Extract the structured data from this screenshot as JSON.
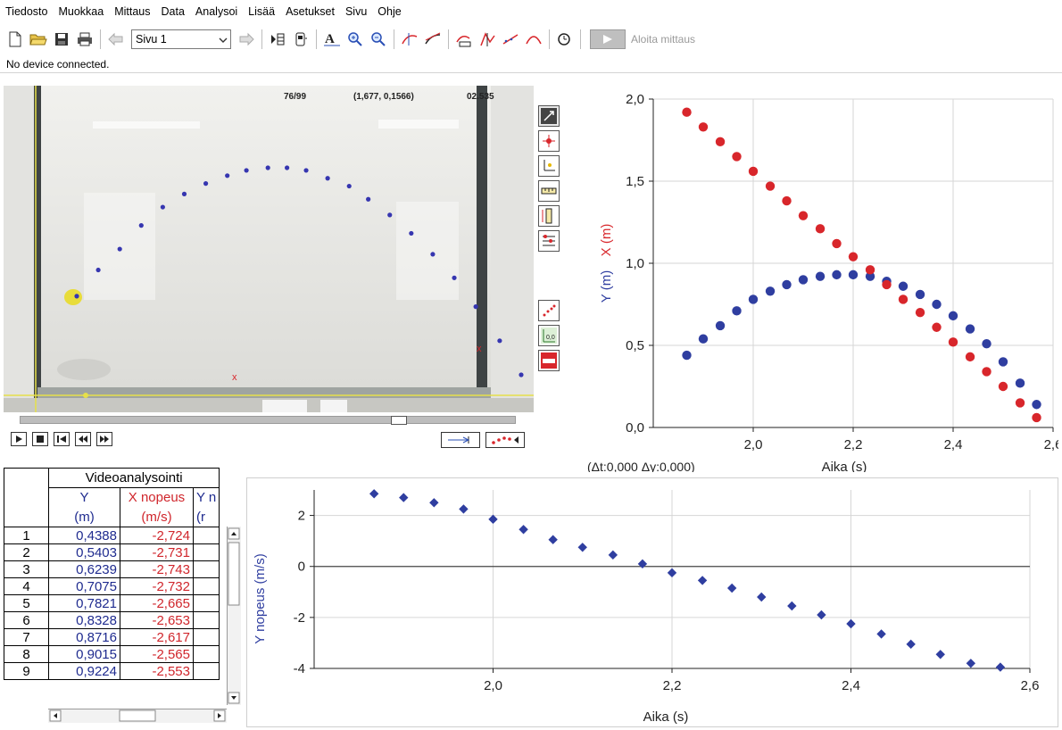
{
  "menu": [
    "Tiedosto",
    "Muokkaa",
    "Mittaus",
    "Data",
    "Analysoi",
    "Lisää",
    "Asetukset",
    "Sivu",
    "Ohje"
  ],
  "toolbar": {
    "page_select_value": "Sivu 1",
    "start_measurement_label": "Aloita mittaus",
    "icons": [
      "new-file-icon",
      "open-folder-icon",
      "save-icon",
      "print-icon",
      "prev-page-icon",
      "next-page-icon",
      "data-browser-icon",
      "sensor-icon",
      "autoscale-icon",
      "zoom-in-icon",
      "zoom-out-icon",
      "examine-icon",
      "tangent-icon",
      "statistics-icon",
      "integral-icon",
      "linear-fit-icon",
      "curve-fit-icon",
      "replay-icon"
    ]
  },
  "status": {
    "text": "No device connected."
  },
  "video": {
    "frame_counter": "76/99",
    "coordinate_readout": "(1,677, 0,1566)",
    "time_readout": "02.535",
    "marker_label": "x",
    "colors": {
      "track": "#3636b0",
      "ball": "#e8dc3a",
      "axis": "#e6e04a"
    }
  },
  "graph_top": {
    "x_label": "Aika (s)",
    "y_label_y": "Y (m)",
    "y_label_x": "X (m)",
    "delta_readout": "(Δt:0,000  Δy:0,000)",
    "x_ticks": [
      "2,0",
      "2,2",
      "2,4",
      "2,6"
    ],
    "y_ticks": [
      "0,0",
      "0,5",
      "1,0",
      "1,5",
      "2,0"
    ],
    "colors": {
      "y_series": "#2f3ea0",
      "x_series": "#d8262b"
    }
  },
  "graph_bottom": {
    "x_label": "Aika (s)",
    "y_label": "Y nopeus (m/s)",
    "x_ticks": [
      "2,0",
      "2,2",
      "2,4",
      "2,6"
    ],
    "y_ticks": [
      "2",
      "0",
      "-2",
      "-4"
    ],
    "color": "#2f3ea0"
  },
  "table": {
    "title": "Videoanalysointi",
    "headers": [
      {
        "name": "Y",
        "unit": "(m)"
      },
      {
        "name": "X nopeus",
        "unit": "(m/s)"
      },
      {
        "name": "Y n",
        "unit": "(r"
      }
    ],
    "rows": [
      {
        "n": "1",
        "y": "0,4388",
        "vx": "-2,724"
      },
      {
        "n": "2",
        "y": "0,5403",
        "vx": "-2,731"
      },
      {
        "n": "3",
        "y": "0,6239",
        "vx": "-2,743"
      },
      {
        "n": "4",
        "y": "0,7075",
        "vx": "-2,732"
      },
      {
        "n": "5",
        "y": "0,7821",
        "vx": "-2,665"
      },
      {
        "n": "6",
        "y": "0,8328",
        "vx": "-2,653"
      },
      {
        "n": "7",
        "y": "0,8716",
        "vx": "-2,617"
      },
      {
        "n": "8",
        "y": "0,9015",
        "vx": "-2,565"
      },
      {
        "n": "9",
        "y": "0,9224",
        "vx": "-2,553"
      }
    ]
  },
  "chart_data": [
    {
      "type": "scatter",
      "title": "",
      "xlabel": "Aika (s)",
      "ylabel": "Y (m), X (m)",
      "xlim": [
        1.8,
        2.6
      ],
      "ylim": [
        0.0,
        2.0
      ],
      "grid": true,
      "x": [
        1.867,
        1.9,
        1.934,
        1.967,
        2.0,
        2.034,
        2.067,
        2.1,
        2.134,
        2.167,
        2.2,
        2.234,
        2.267,
        2.3,
        2.334,
        2.367,
        2.4,
        2.434,
        2.467,
        2.5,
        2.534,
        2.567
      ],
      "series": [
        {
          "name": "Y",
          "values": [
            0.44,
            0.54,
            0.62,
            0.71,
            0.78,
            0.83,
            0.87,
            0.9,
            0.92,
            0.93,
            0.93,
            0.92,
            0.89,
            0.86,
            0.81,
            0.75,
            0.68,
            0.6,
            0.51,
            0.4,
            0.27,
            0.14
          ]
        },
        {
          "name": "X",
          "values": [
            1.92,
            1.83,
            1.74,
            1.65,
            1.56,
            1.47,
            1.38,
            1.29,
            1.21,
            1.12,
            1.04,
            0.96,
            0.87,
            0.78,
            0.7,
            0.61,
            0.52,
            0.43,
            0.34,
            0.25,
            0.15,
            0.06
          ]
        }
      ]
    },
    {
      "type": "scatter",
      "title": "",
      "xlabel": "Aika (s)",
      "ylabel": "Y nopeus (m/s)",
      "xlim": [
        1.8,
        2.6
      ],
      "ylim": [
        -4,
        3
      ],
      "grid": true,
      "x": [
        1.867,
        1.9,
        1.934,
        1.967,
        2.0,
        2.034,
        2.067,
        2.1,
        2.134,
        2.167,
        2.2,
        2.234,
        2.267,
        2.3,
        2.334,
        2.367,
        2.4,
        2.434,
        2.467,
        2.5,
        2.534,
        2.567
      ],
      "series": [
        {
          "name": "Y nopeus",
          "values": [
            2.85,
            2.7,
            2.5,
            2.25,
            1.85,
            1.45,
            1.05,
            0.75,
            0.45,
            0.1,
            -0.25,
            -0.55,
            -0.85,
            -1.2,
            -1.55,
            -1.9,
            -2.25,
            -2.65,
            -3.05,
            -3.45,
            -3.8,
            -3.95
          ]
        }
      ]
    }
  ]
}
